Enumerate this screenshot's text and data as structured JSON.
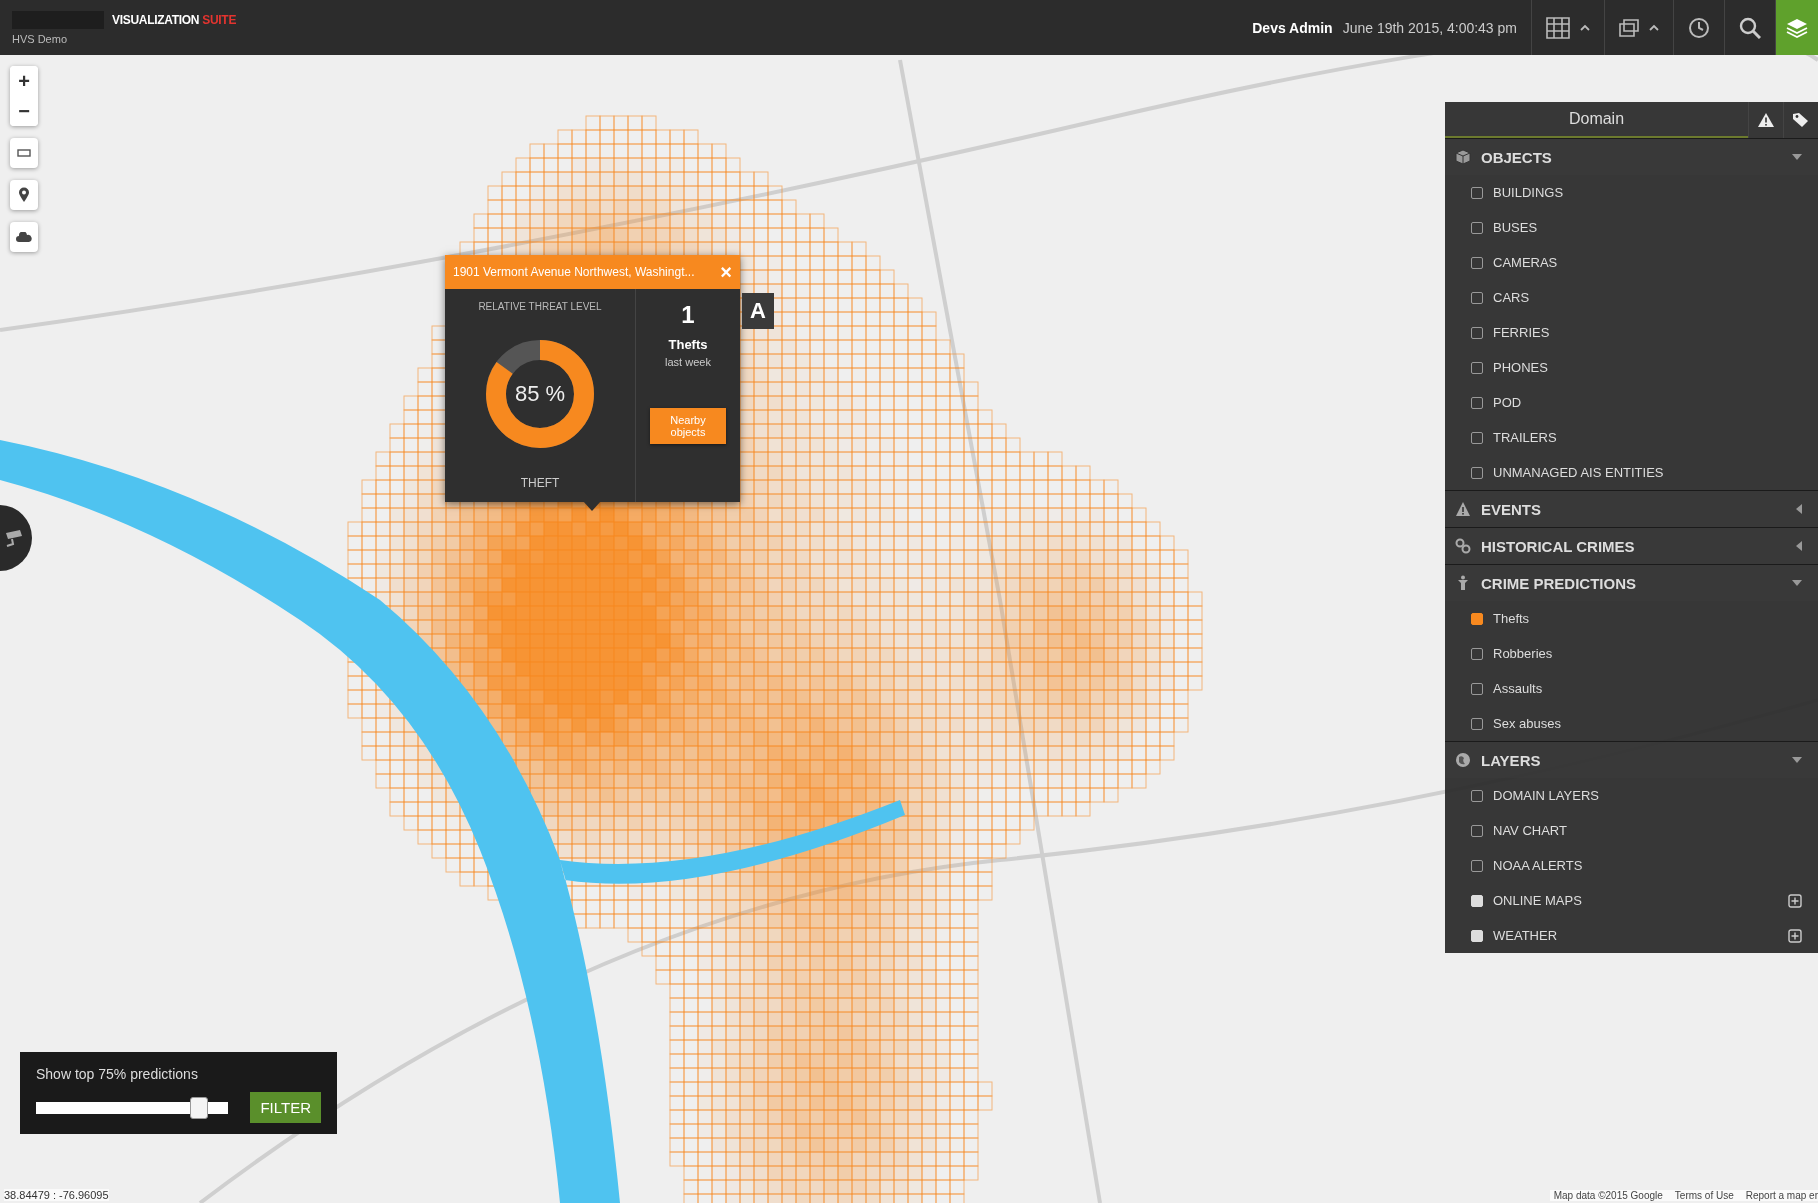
{
  "header": {
    "brand": "VISUALIZATION",
    "brand_accent": "SUITE",
    "subtitle": "HVS Demo",
    "user": "Devs Admin",
    "datetime": "June 19th 2015, 4:00:43 pm"
  },
  "map_controls": {
    "zoom_in": "+",
    "zoom_out": "−"
  },
  "popup": {
    "title": "1901 Vermont Avenue Northwest, Washingt...",
    "close": "×",
    "threat_label": "RELATIVE THREAT LEVEL",
    "level": 0.85,
    "percent": "85 %",
    "category": "THEFT",
    "count": "1",
    "count_label": "Thefts",
    "period": "last week",
    "button": "Nearby objects"
  },
  "marker_label": "A",
  "panel": {
    "title": "Domain",
    "sections": [
      {
        "title": "OBJECTS",
        "kind": "list",
        "expanded": true,
        "items": [
          {
            "label": "BUILDINGS",
            "checked": false,
            "expandable": false
          },
          {
            "label": "BUSES",
            "checked": false,
            "expandable": false
          },
          {
            "label": "CAMERAS",
            "checked": false,
            "expandable": false
          },
          {
            "label": "CARS",
            "checked": false,
            "expandable": false
          },
          {
            "label": "FERRIES",
            "checked": false,
            "expandable": false
          },
          {
            "label": "PHONES",
            "checked": false,
            "expandable": false
          },
          {
            "label": "POD",
            "checked": false,
            "expandable": false
          },
          {
            "label": "TRAILERS",
            "checked": false,
            "expandable": false
          },
          {
            "label": "UNMANAGED AIS ENTITIES",
            "checked": false,
            "expandable": false
          }
        ]
      },
      {
        "title": "EVENTS",
        "expanded": false
      },
      {
        "title": "HISTORICAL CRIMES",
        "expanded": false
      },
      {
        "title": "CRIME PREDICTIONS",
        "kind": "predictions",
        "expanded": true,
        "items": [
          {
            "label": "Thefts",
            "checked": true,
            "expandable": false
          },
          {
            "label": "Robberies",
            "checked": false,
            "expandable": false
          },
          {
            "label": "Assaults",
            "checked": false,
            "expandable": false
          },
          {
            "label": "Sex abuses",
            "checked": false,
            "expandable": false
          }
        ]
      },
      {
        "title": "LAYERS",
        "kind": "list",
        "expanded": true,
        "items": [
          {
            "label": "DOMAIN LAYERS",
            "checked": false,
            "expandable": false
          },
          {
            "label": "NAV CHART",
            "checked": false,
            "expandable": false
          },
          {
            "label": "NOAA ALERTS",
            "checked": false,
            "expandable": false
          },
          {
            "label": "ONLINE MAPS",
            "checked": true,
            "expandable": true
          },
          {
            "label": "WEATHER",
            "checked": true,
            "expandable": true
          }
        ]
      }
    ]
  },
  "filter": {
    "label": "Show top 75% predictions",
    "level": 0.88,
    "button": "FILTER"
  },
  "status": {
    "coordinates": "38.84479 : -76.96095",
    "attribution": [
      "Map data ©2015 Google",
      "Terms of Use",
      "Report a map er"
    ]
  }
}
